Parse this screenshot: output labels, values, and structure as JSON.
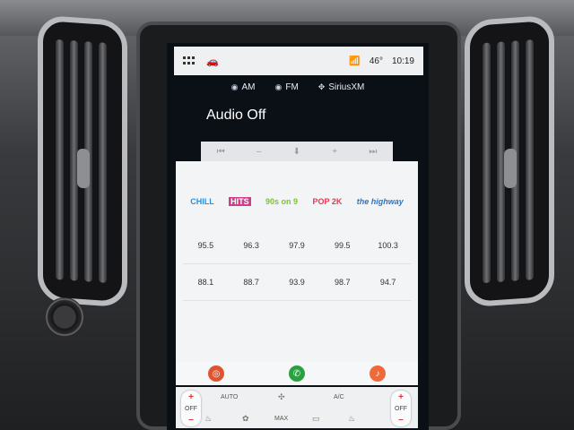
{
  "status_bar": {
    "grid_icon": "grid-icon",
    "car_icon": "car-icon",
    "signal_icon": "signal-icon",
    "temperature": "46°",
    "time": "10:19"
  },
  "sources": [
    {
      "label": "AM",
      "icon": "am-icon"
    },
    {
      "label": "FM",
      "icon": "fm-icon"
    },
    {
      "label": "SiriusXM",
      "icon": "siriusxm-icon"
    }
  ],
  "now_playing": "Audio Off",
  "transport": [
    "⏮",
    "–",
    "⬇",
    "+",
    "⏭"
  ],
  "station_logos": [
    "CHILL",
    "HITS",
    "90s on 9",
    "POP 2K",
    "the highway"
  ],
  "presets": [
    [
      "95.5",
      "96.3",
      "97.9",
      "99.5",
      "100.3"
    ],
    [
      "88.1",
      "88.7",
      "93.9",
      "98.7",
      "94.7"
    ]
  ],
  "apps": [
    "podcast-icon",
    "phone-icon",
    "music-icon"
  ],
  "climate": {
    "left_temp": "OFF",
    "right_temp": "OFF",
    "auto_label": "AUTO",
    "ac_label": "A/C",
    "max_label": "MAX"
  },
  "colors": {
    "accent_red": "#e0532f",
    "phone_green": "#2aa040",
    "music_orange": "#ef6a3a"
  }
}
